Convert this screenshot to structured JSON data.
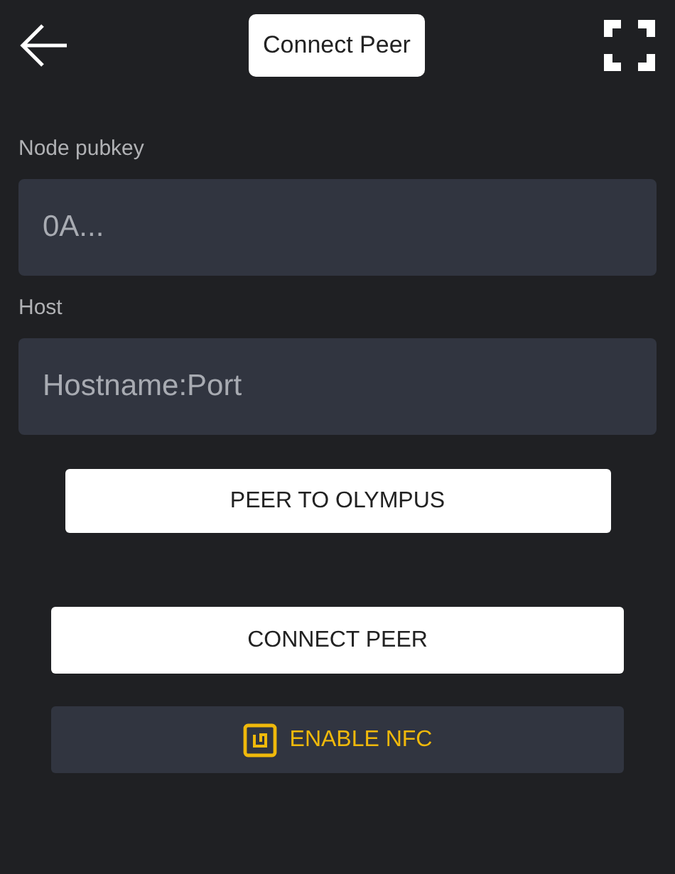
{
  "header": {
    "title": "Connect Peer"
  },
  "fields": [
    {
      "label": "Node pubkey",
      "placeholder": "0A..."
    },
    {
      "label": "Host",
      "placeholder": "Hostname:Port"
    }
  ],
  "buttons": [
    {
      "label": "PEER TO OLYMPUS",
      "kind": "light-inset"
    },
    {
      "label": "CONNECT PEER",
      "kind": "light"
    },
    {
      "label": "ENABLE NFC",
      "kind": "nfc"
    }
  ]
}
